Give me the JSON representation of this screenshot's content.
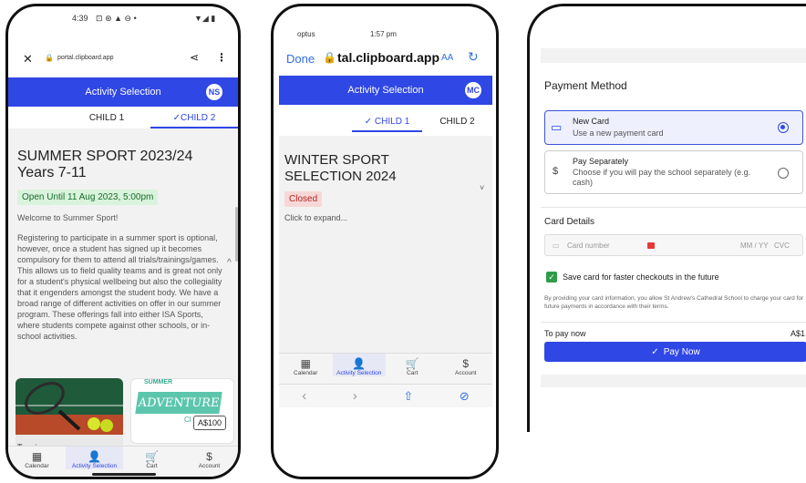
{
  "phone1": {
    "status_time": "4:39",
    "status_icons_left": "⊡ ⊛ ▲ ⊖ •",
    "status_icons_right": "▼◢ ▮",
    "url": "portal.clipboard.app",
    "header_title": "Activity Selection",
    "avatar": "NS",
    "tabs": [
      "CHILD 1",
      "CHILD 2"
    ],
    "title": "SUMMER SPORT 2023/24 Years 7-11",
    "badge": "Open Until 11 Aug 2023, 5:00pm",
    "welcome": "Welcome to Summer Sport!",
    "description": "Registering to participate in a summer sport is optional, however, once a student has signed up it becomes compulsory for them to attend all trials/trainings/games. This allows us to field quality teams and is great not only for a student's physical wellbeing but also the collegiality that it engenders amongst the student body. We have a broad range of different activities on offer in our summer program. These offerings fall into either ISA Sports, where students compete against other schools, or in-school activities.",
    "card1_label": "Tennis",
    "card2_banner_top": "SUMMER",
    "card2_banner": "ADVENTURE",
    "card2_cut": "Cl",
    "card2_price": "A$100",
    "nav": [
      "Calendar",
      "Activity Selection",
      "Cart",
      "Account"
    ]
  },
  "phone2": {
    "status_carrier": "optus",
    "status_time": "1:57 pm",
    "done_label": "Done",
    "url": "tal.clipboard.app",
    "aa_label": "AA",
    "header_title": "Activity Selection",
    "avatar": "MC",
    "tabs": [
      "CHILD 1",
      "CHILD 2"
    ],
    "title": "WINTER SPORT SELECTION 2024",
    "badge": "Closed",
    "expand_text": "Click to expand...",
    "nav": [
      "Calendar",
      "Activity Selection",
      "Cart",
      "Account"
    ]
  },
  "phone3": {
    "payment_method_title": "Payment Method",
    "new_card_title": "New Card",
    "new_card_sub": "Use a new payment card",
    "separate_title": "Pay Separately",
    "separate_sub": "Choose if you will pay the school separately (e.g. cash)",
    "card_details_title": "Card Details",
    "card_number_placeholder": "Card number",
    "expiry_placeholder": "MM / YY",
    "cvc_placeholder": "CVC",
    "save_card_label": "Save card for faster checkouts in the future",
    "disclaimer": "By providing your card information, you allow St Andrew's Cathedral School to charge your card for future payments in accordance with their terms.",
    "to_pay_label": "To pay now",
    "to_pay_amount": "A$1",
    "pay_button": "Pay Now"
  },
  "colors": {
    "accent": "#2f47e4",
    "green_badge": "#d9f3dc",
    "red_badge": "#f8d7d7"
  }
}
